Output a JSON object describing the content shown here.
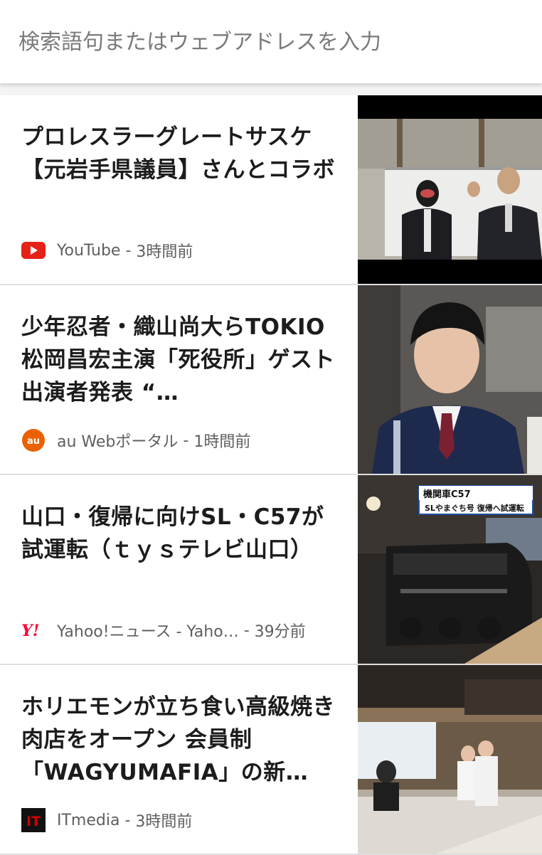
{
  "search": {
    "placeholder": "検索語句またはウェブアドレスを入力"
  },
  "feed": [
    {
      "title": "プロレスラーグレートサスケ【元岩手県議員】さんとコラボ",
      "source": "YouTube",
      "time": "3時間前",
      "source_icon": "youtube-icon",
      "icon_color": "#e62117"
    },
    {
      "title": "少年忍者・織山尚大らTOKIO松岡昌宏主演「死役所」ゲスト出演者発表 “…",
      "source": "au Webポータル",
      "time": "1時間前",
      "source_icon": "au-icon",
      "icon_color": "#eb6100"
    },
    {
      "title": "山口・復帰に向けSL・C57が試運転（ｔｙｓテレビ山口）",
      "source": "Yahoo!ニュース - Yaho…",
      "time": "39分前",
      "source_icon": "yahoo-icon",
      "icon_color": "#ff0033"
    },
    {
      "title": "ホリエモンが立ち食い高級焼き肉店をオープン 会員制「WAGYUMAFIA」の新…",
      "source": "ITmedia",
      "time": "3時間前",
      "source_icon": "itmedia-icon",
      "icon_color": "#d40000"
    }
  ],
  "thumbs": {
    "train_caption_1": "機関車C57",
    "train_caption_2": "SLやまぐち号 復帰へ試運転"
  }
}
